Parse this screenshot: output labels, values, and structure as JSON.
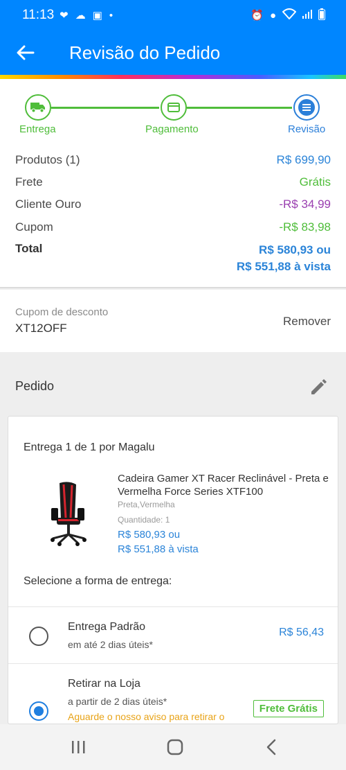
{
  "status_bar": {
    "time": "11:13",
    "left_icons": [
      "heart-shield-icon",
      "cloud-icon",
      "image-icon",
      "dot-icon"
    ],
    "right_icons": [
      "alarm-icon",
      "location-icon",
      "wifi-icon",
      "signal-icon",
      "battery-icon"
    ]
  },
  "header": {
    "title": "Revisão do Pedido",
    "accent_color": "#0086ff"
  },
  "stepper": {
    "steps": [
      {
        "label": "Entrega",
        "icon": "truck-icon",
        "status": "done"
      },
      {
        "label": "Pagamento",
        "icon": "card-icon",
        "status": "done"
      },
      {
        "label": "Revisão",
        "icon": "list-icon",
        "status": "active"
      }
    ]
  },
  "summary": {
    "rows": [
      {
        "label": "Produtos (1)",
        "value": "R$ 699,90"
      },
      {
        "label": "Frete",
        "value": "Grátis"
      },
      {
        "label": "Cliente Ouro",
        "value": "-R$ 34,99"
      },
      {
        "label": "Cupom",
        "value": "-R$ 83,98"
      }
    ],
    "total_label": "Total",
    "total_value_1": "R$ 580,93 ou",
    "total_value_2": "R$ 551,88 à vista"
  },
  "coupon": {
    "label": "Cupom de desconto",
    "code": "XT12OFF",
    "remove_label": "Remover"
  },
  "order": {
    "title": "Pedido",
    "delivery_header": "Entrega 1 de 1 por Magalu",
    "product": {
      "name": "Cadeira Gamer XT Racer Reclinável - Preta e Vermelha Force Series XTF100",
      "color": "Preta,Vermelha",
      "quantity": "Quantidade:  1",
      "price_1": "R$ 580,93 ou",
      "price_2": "R$ 551,88 à vista"
    },
    "shipping_title": "Selecione a forma de entrega:",
    "options": [
      {
        "title": "Entrega Padrão",
        "subtitle": "em até 2 dias úteis*",
        "price": "R$ 56,43",
        "selected": false
      },
      {
        "title": "Retirar na Loja",
        "subtitle": "a partir de 2 dias úteis*",
        "note": "Aguarde o nosso aviso para retirar o",
        "badge": "Frete Grátis",
        "selected": true
      }
    ]
  },
  "navbar": {
    "buttons": [
      "recent-apps-icon",
      "home-icon",
      "back-icon"
    ]
  }
}
